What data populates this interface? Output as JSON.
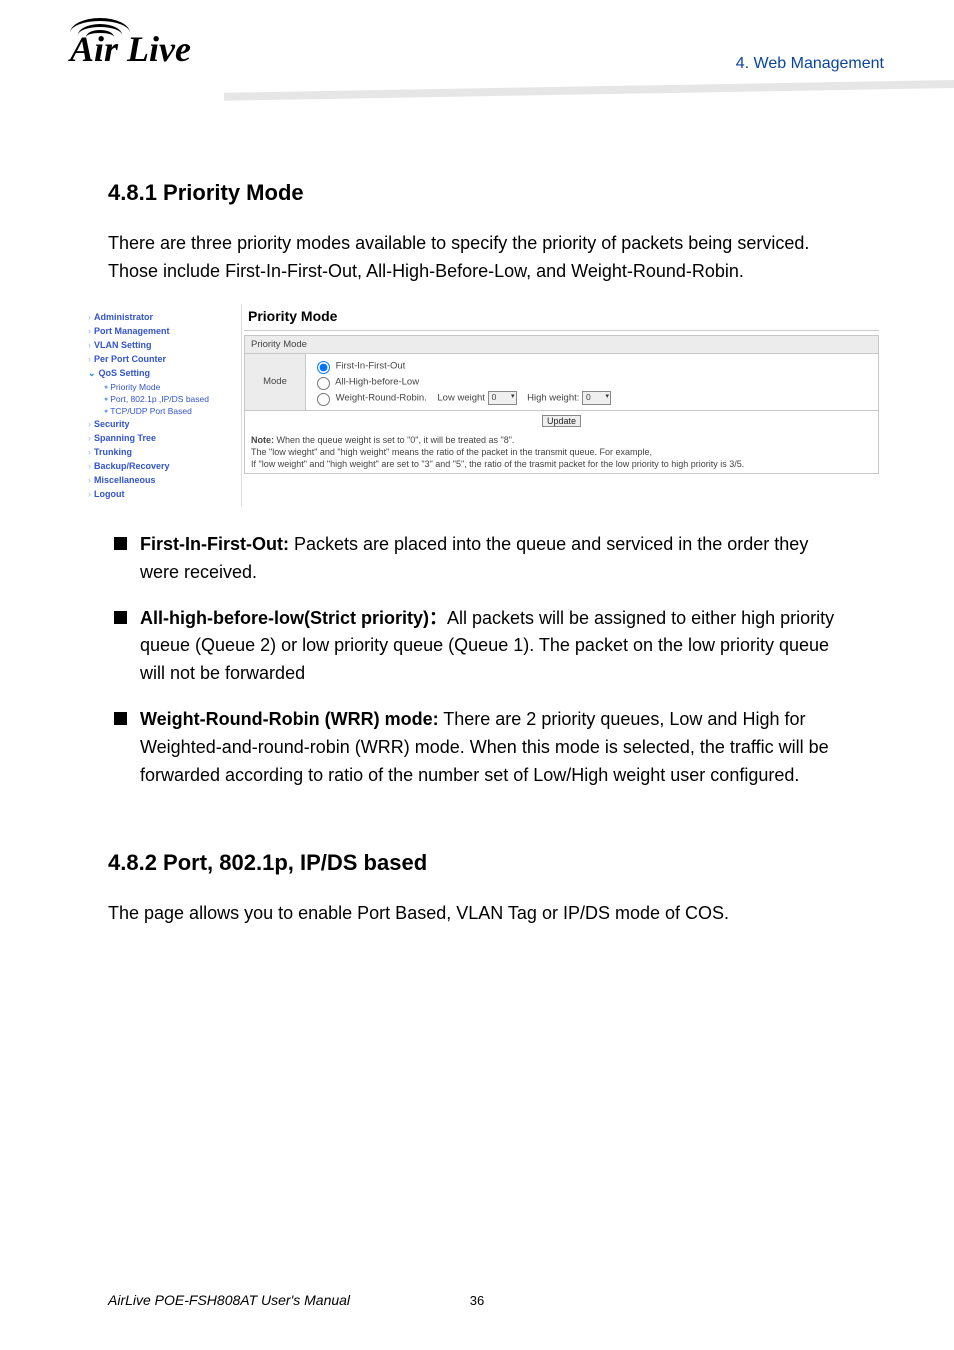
{
  "header": {
    "chapter_label": "4. Web Management",
    "logo_text": "Air Live"
  },
  "body": {
    "heading_1": "4.8.1 Priority Mode",
    "intro": "There are three priority modes available to specify the priority of packets being serviced. Those include First-In-First-Out, All-High-Before-Low, and Weight-Round-Robin.",
    "screenshot": {
      "nav": {
        "admin": "Administrator",
        "port_mgmt": "Port Management",
        "vlan": "VLAN Setting",
        "per_port": "Per Port Counter",
        "qos": "QoS Setting",
        "qos_sub": {
          "priority_mode": "Priority Mode",
          "port_based": "Port, 802.1p ,IP/DS based",
          "tcpudp": "TCP/UDP Port Based"
        },
        "security": "Security",
        "spanning": "Spanning Tree",
        "trunking": "Trunking",
        "backup": "Backup/Recovery",
        "misc": "Miscellaneous",
        "logout": "Logout"
      },
      "title": "Priority Mode",
      "panel_label": "Priority Mode",
      "mode_label": "Mode",
      "opt_fifo": "First-In-First-Out",
      "opt_all_high": "All-High-before-Low",
      "opt_wrr": "Weight-Round-Robin.",
      "low_weight_label": "Low weight",
      "high_weight_label": "High weight:",
      "low_weight_value": "0",
      "high_weight_value": "0",
      "update_btn": "Update",
      "note1_strong": "Note:",
      "note1_rest": " When the queue weight is set to \"0\", it will be treated as \"8\".",
      "note2": "The \"low wieght\" and \"high weight\" means the ratio of the packet in the transmit queue. For example,",
      "note3": "If \"low weight\" and \"high weight\" are set to \"3\" and \"5\", the ratio of the trasmit packet for the low priority to high priority is 3/5."
    },
    "bullets": {
      "b1_strong": "First-In-First-Out:",
      "b1_rest": " Packets are placed into the queue and serviced in the order they were received.",
      "b2_strong": "All-high-before-low(Strict priority)：",
      "b2_rest": "All packets will be assigned to either high priority queue (Queue 2) or low priority queue (Queue 1). The packet on the low priority queue will not be forwarded",
      "b3_strong": "Weight-Round-Robin (WRR) mode:",
      "b3_rest": " There are 2 priority queues, Low and High for Weighted-and-round-robin (WRR) mode. When this mode is selected, the traffic will be forwarded according to ratio of the number set of Low/High weight user configured."
    },
    "heading_2": "4.8.2 Port, 802.1p, IP/DS based",
    "para_2": "The page allows you to enable Port Based, VLAN Tag or IP/DS mode of COS."
  },
  "footer": {
    "manual": "AirLive POE-FSH808AT User's Manual",
    "page_number": "36"
  }
}
